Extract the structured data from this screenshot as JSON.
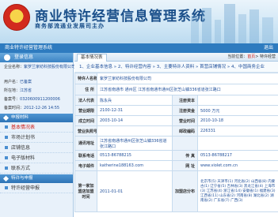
{
  "header": {
    "title": "商业特许经营信息管理系统",
    "subtitle": "商务部流通业发展司主办"
  },
  "navbar": {
    "title": "商业特许经营管理系统",
    "logout": "退出"
  },
  "sidebar": {
    "section_title": "登录信息",
    "info": [
      {
        "label": "企业名称：",
        "value": "紫罗兰家纺科技股份有限公司"
      },
      {
        "label": "用户名：",
        "value": "已备案"
      },
      {
        "label": "所在地：",
        "value": "江苏省"
      },
      {
        "label": "备案号：",
        "value": "0320600911200006"
      },
      {
        "label": "备案时间：",
        "value": "2012-12-26 14:55"
      }
    ],
    "menu_groups": [
      {
        "title": "申报材料",
        "items": [
          "基本情况表",
          "市场计划书",
          "店铺信息",
          "电子版材料",
          "联系方式"
        ]
      },
      {
        "title": "特许与申报",
        "items": [
          "特许经营申报"
        ]
      }
    ],
    "active_item": "基本情况表"
  },
  "main": {
    "tab_label": "基本情况表",
    "tab_right_prefix": "当前位置：",
    "tab_right_link": "首页",
    "tab_right_suffix": "> 特许经营",
    "steps": "1、企业基本信息 » 2、特许经营内容 » 3、主要特许人资料 » 首营店铺情况 » 4、中国商务企业",
    "rows": [
      {
        "label": "特许人名称",
        "value": "紫罗兰家纺科技股份有限公司"
      },
      {
        "label": "住  所",
        "value": "江苏省南通市  通州区  江苏省南通市通州区张芝山镇336省道张江路口"
      },
      {
        "label": "法人代表",
        "value": "陈永兵",
        "label2": "注册资本",
        "value2": ""
      },
      {
        "label": "营业期限",
        "value": "2100-12-31",
        "label2": "注册资金",
        "value2": "5000 万元"
      },
      {
        "label": "成立时间",
        "value": "2003-10-14",
        "label2": "营业时间",
        "value2": "2010-10-18"
      },
      {
        "label": "营业执照号",
        "value": "",
        "label2": "邮政编码",
        "value2": "226331"
      },
      {
        "label": "通讯地址",
        "value": "江苏省南通市通州区张芝山镇336省道张江路口",
        "label2": "",
        "value2": ""
      },
      {
        "label": "联系电话",
        "value": "0513-86788215",
        "label2": "传  真",
        "value2": "0513-86788217"
      },
      {
        "label": "电子邮件",
        "value": "katherine188163.com",
        "label2": "网  址",
        "value2": "www.violet.com.cn"
      },
      {
        "label": "第一家加盟店加盟时间",
        "value": "2011-01-01",
        "label2": "加盟店分布",
        "value2": "北京市(5) 天津市(1) 河北省(2) 山西省(8) 内蒙古(1) 辽宁省(5) 吉林省(3) 黑龙江省(4) 上海市(3) 江苏省(4) 浙江省(14) 安徽省(1) 福建省(3) 江西省(11) 山东省(2) 河南省(8) 湖北省(2) 湖南省(2) 广东省(7) 广西(3)"
      }
    ]
  },
  "colors": {
    "nav_bar": "#2e7bbf",
    "title": "#1a4f8a",
    "value_text": "#1f4f9a",
    "active_link": "#d0211b"
  }
}
